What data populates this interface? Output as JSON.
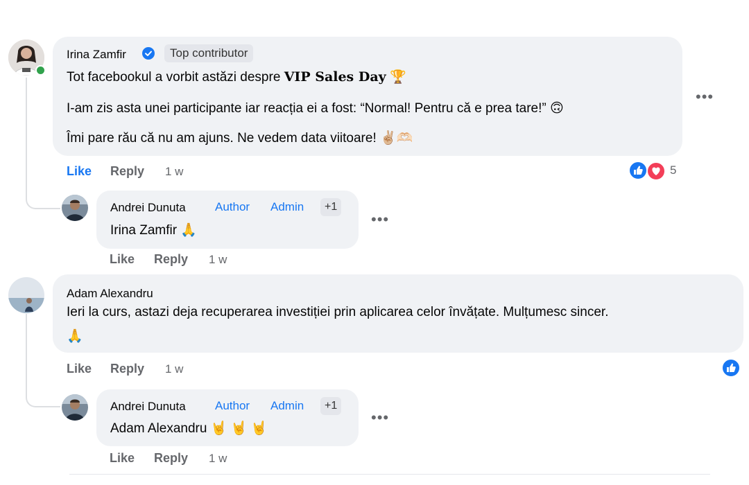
{
  "comments": [
    {
      "author": "Irina Zamfir",
      "badge": "Top contributor",
      "lines": {
        "l1_prefix": "Tot facebookul a vorbit astăzi despre",
        "l1_bold": "VIP Sales Day",
        "l1_emoji": "🏆",
        "l2": "I-am zis asta unei participante iar reacția ei a fost: “Normal! Pentru că e prea tare!”",
        "l2_emoji": "🙃",
        "l3": "Îmi pare rău că nu am ajuns. Ne vedem data viitoare!",
        "l3_emoji": "✌🏼🫶🏻"
      },
      "actions": {
        "like": "Like",
        "reply": "Reply",
        "time": "1 w"
      },
      "reaction_count": "5",
      "more": "•••",
      "reply": {
        "author": "Andrei Dunuta",
        "badges": [
          "Author",
          "Admin"
        ],
        "badge_more": "+1",
        "text": "Irina Zamfir",
        "emoji": "🙏",
        "actions": {
          "like": "Like",
          "reply": "Reply",
          "time": "1 w"
        },
        "more": "•••"
      }
    },
    {
      "author": "Adam Alexandru",
      "line1": "Ieri la curs, astazi deja recuperarea investiției prin aplicarea celor învățate. Mulțumesc sincer.",
      "line2_emoji": "🙏",
      "actions": {
        "like": "Like",
        "reply": "Reply",
        "time": "1 w"
      },
      "reply": {
        "author": "Andrei Dunuta",
        "badges": [
          "Author",
          "Admin"
        ],
        "badge_more": "+1",
        "text": "Adam Alexandru",
        "emoji": "🤘 🤘 🤘",
        "actions": {
          "like": "Like",
          "reply": "Reply",
          "time": "1 w"
        },
        "more": "•••"
      }
    }
  ],
  "icons": {
    "verified": "verified-badge-icon",
    "like_reaction": "like-reaction-icon",
    "love_reaction": "love-reaction-icon"
  },
  "colors": {
    "accent": "#1877f2",
    "bubble": "#f0f2f5",
    "meta": "#65676b",
    "love": "#f33e58",
    "online": "#31a24c"
  }
}
